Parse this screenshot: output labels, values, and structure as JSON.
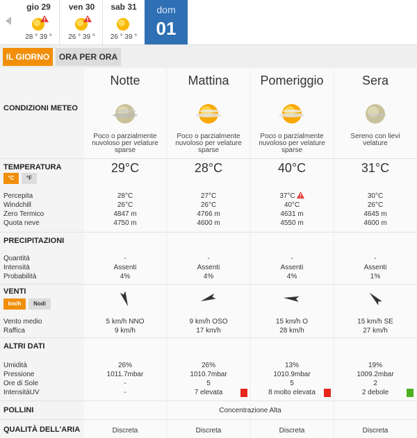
{
  "days": [
    {
      "name": "gio 29",
      "temps": "28 ° 39 °",
      "warning": true
    },
    {
      "name": "ven 30",
      "temps": "26 ° 39 °",
      "warning": true
    },
    {
      "name": "sab 31",
      "temps": "26 ° 39 °",
      "warning": false
    }
  ],
  "active_day": {
    "name": "dom",
    "number": "01"
  },
  "tabs": {
    "day": "IL GIORNO",
    "hour": "ORA PER ORA"
  },
  "columns": [
    "Notte",
    "Mattina",
    "Pomeriggio",
    "Sera"
  ],
  "sections": {
    "conditions": "CONDIZIONI METEO",
    "temperature": "TEMPERATURA",
    "precipitation": "PRECIPITAZIONI",
    "wind": "VENTI",
    "other": "ALTRI DATI",
    "pollen": "POLLINI",
    "air": "QUALITÀ DELL'ARIA"
  },
  "units": {
    "celsius": "°C",
    "fahrenheit": "°F",
    "kmh": "km/h",
    "knots": "Nodi"
  },
  "conditions": [
    "Poco o parzialmente nuvoloso per velature sparse",
    "Poco o parzialmente nuvoloso per velature sparse",
    "Poco o parzialmente nuvoloso per velature sparse",
    "Sereno con lievi velature"
  ],
  "temperature": {
    "main": [
      "29°C",
      "28°C",
      "40°C",
      "31°C"
    ],
    "labels": [
      "Percepita",
      "Windchill",
      "Zero Termico",
      "Quota neve"
    ],
    "rows": [
      [
        "28°C",
        "27°C",
        "37°C",
        "30°C"
      ],
      [
        "26°C",
        "26°C",
        "40°C",
        "26°C"
      ],
      [
        "4847 m",
        "4766 m",
        "4631 m",
        "4645 m"
      ],
      [
        "4750 m",
        "4600 m",
        "4550 m",
        "4600 m"
      ]
    ]
  },
  "precipitation": {
    "labels": [
      "Quantità",
      "Intensità",
      "Probabilità"
    ],
    "rows": [
      [
        "-",
        "-",
        "-",
        "-"
      ],
      [
        "Assenti",
        "Assenti",
        "Assenti",
        "Assenti"
      ],
      [
        "4%",
        "4%",
        "4%",
        "1%"
      ]
    ]
  },
  "wind": {
    "labels": [
      "Vento medio",
      "Raffica"
    ],
    "direction_deg": [
      160,
      250,
      275,
      315
    ],
    "rows": [
      [
        "5 km/h  NNO",
        "9 km/h OSO",
        "15 km/h O",
        "15 km/h SE"
      ],
      [
        "9 km/h",
        "17 km/h",
        "28 km/h",
        "27 km/h"
      ]
    ]
  },
  "other": {
    "labels": [
      "Umidità",
      "Pressione",
      "Ore di Sole",
      "IntensitàUV"
    ],
    "rows": [
      [
        "26%",
        "26%",
        "13%",
        "19%"
      ],
      [
        "1011.7mbar",
        "1010.7mbar",
        "1010.9mbar",
        "1009.2mbar"
      ],
      [
        "-",
        "5",
        "5",
        "2"
      ],
      [
        "-",
        "7 elevata",
        "8 molto elevata",
        "2 debole"
      ]
    ],
    "uv_colors": [
      "",
      "#e8261b",
      "#e8261b",
      "#4caf1f"
    ]
  },
  "pollen": "Concentrazione Alta",
  "air": [
    "Discreta",
    "Discreta",
    "Discreta",
    "Discreta"
  ],
  "colors": {
    "accent": "#f18f0b",
    "active_day": "#2f6fb3",
    "warning": "#e53935"
  }
}
